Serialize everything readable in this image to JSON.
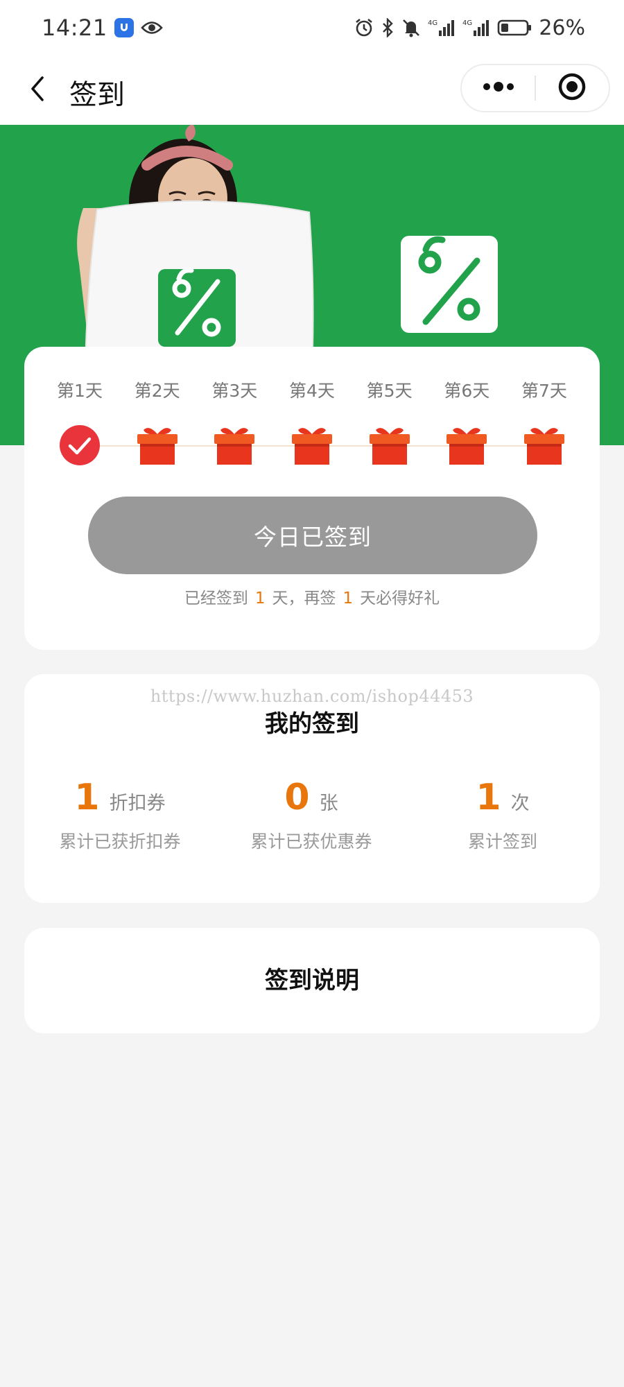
{
  "status_bar": {
    "time": "14:21",
    "battery_percent": "26%",
    "icons": [
      "shield-app-icon",
      "eye-icon",
      "alarm-icon",
      "bluetooth-icon",
      "mute-icon",
      "signal-4g-icon",
      "signal-4g-icon",
      "battery-icon"
    ]
  },
  "nav": {
    "title": "签到",
    "back_icon": "chevron-left-icon",
    "menu_icon": "more-dots-icon",
    "close_icon": "target-circle-icon"
  },
  "banner": {
    "background_color": "#22a24b",
    "badge_symbol_icon": "percent-icon"
  },
  "checkin": {
    "days": [
      {
        "label": "第1天",
        "state": "checked"
      },
      {
        "label": "第2天",
        "state": "gift"
      },
      {
        "label": "第3天",
        "state": "gift"
      },
      {
        "label": "第4天",
        "state": "gift"
      },
      {
        "label": "第5天",
        "state": "gift"
      },
      {
        "label": "第6天",
        "state": "gift"
      },
      {
        "label": "第7天",
        "state": "gift"
      }
    ],
    "button_label": "今日已签到",
    "tip": {
      "prefix": "已经签到",
      "days_signed": "1",
      "middle": "天，再签",
      "days_left": "1",
      "suffix": "天必得好礼"
    }
  },
  "mine": {
    "watermark": "https://www.huzhan.com/ishop44453",
    "title": "我的签到",
    "stats": [
      {
        "value": "1",
        "unit": "折扣券",
        "label": "累计已获折扣券"
      },
      {
        "value": "0",
        "unit": "张",
        "label": "累计已获优惠券"
      },
      {
        "value": "1",
        "unit": "次",
        "label": "累计签到"
      }
    ]
  },
  "rules": {
    "title": "签到说明"
  },
  "colors": {
    "accent_orange": "#e8760c",
    "gift_red": "#e8351e",
    "check_red": "#e8343a",
    "button_gray": "#999999",
    "page_bg": "#f4f4f4"
  }
}
